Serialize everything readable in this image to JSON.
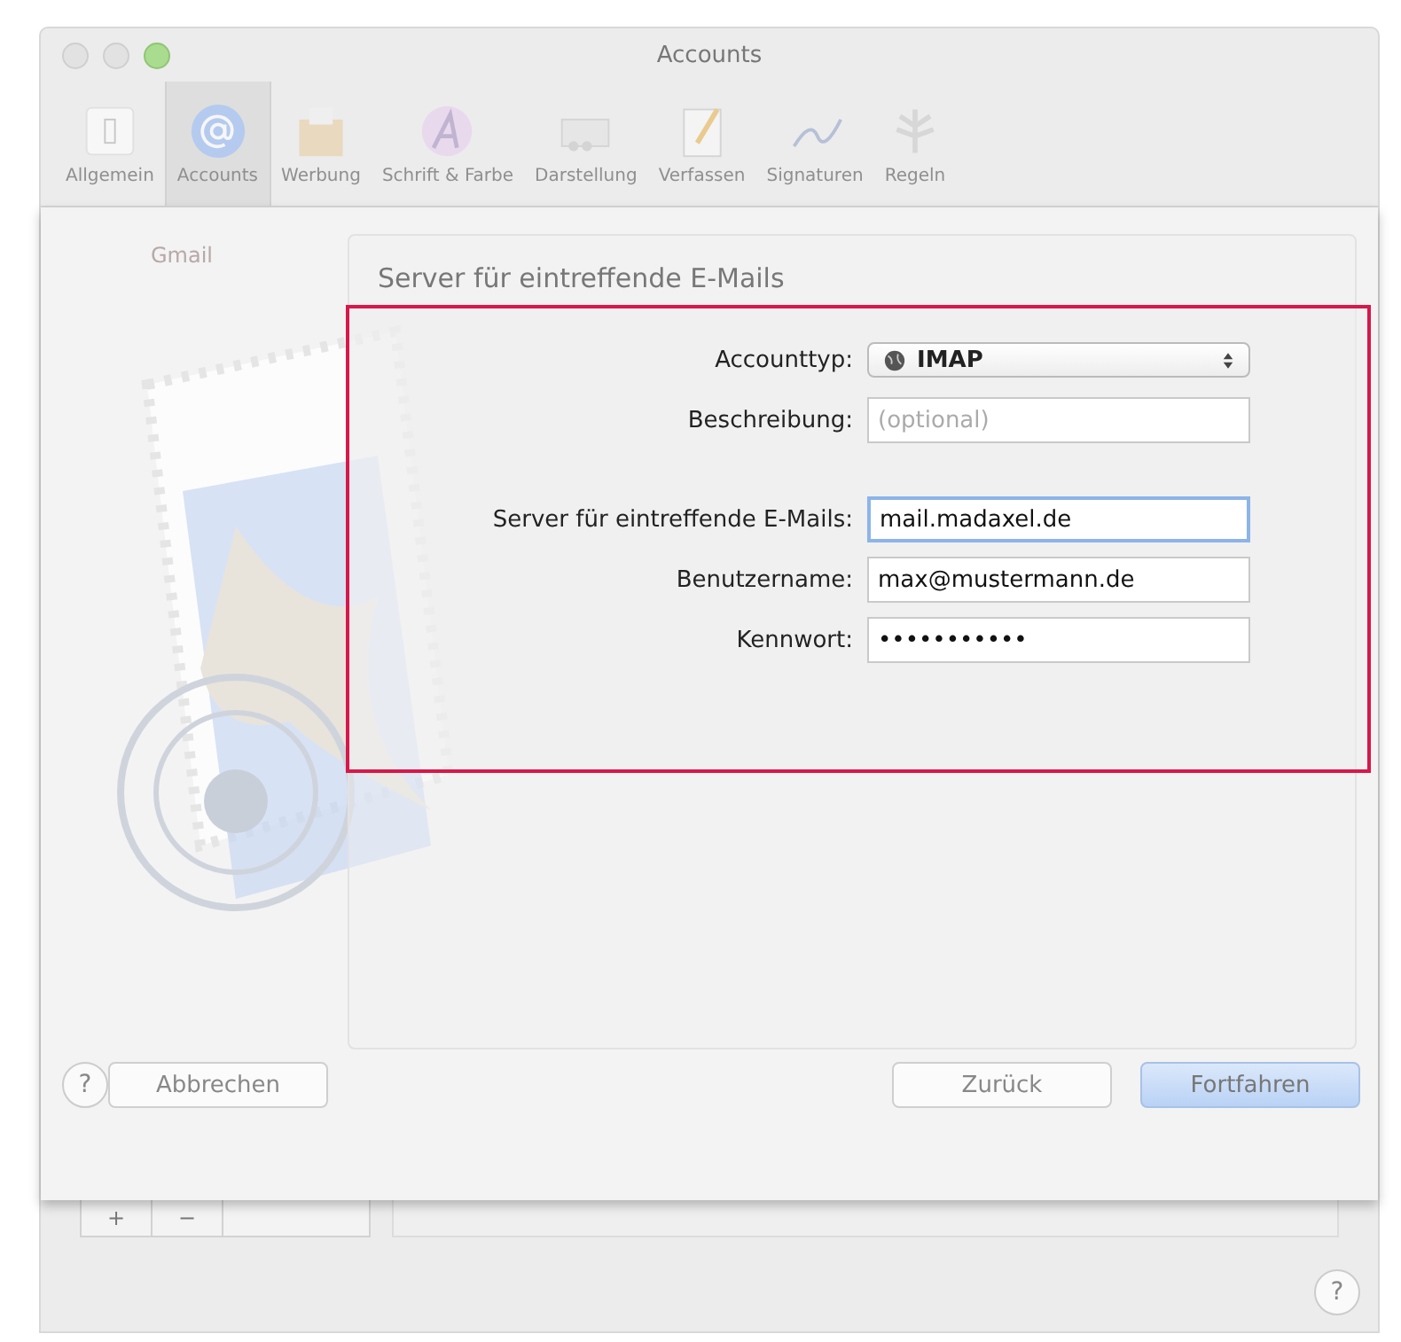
{
  "window": {
    "title": "Accounts"
  },
  "toolbar": [
    {
      "label": "Allgemein",
      "selected": false
    },
    {
      "label": "Accounts",
      "selected": true
    },
    {
      "label": "Werbung",
      "selected": false
    },
    {
      "label": "Schrift & Farbe",
      "selected": false
    },
    {
      "label": "Darstellung",
      "selected": false
    },
    {
      "label": "Verfassen",
      "selected": false
    },
    {
      "label": "Signaturen",
      "selected": false
    },
    {
      "label": "Regeln",
      "selected": false
    }
  ],
  "sidebar": {
    "items": [
      {
        "label": "Gmail"
      }
    ]
  },
  "sheet": {
    "heading": "Server für eintreffende E-Mails",
    "fields": [
      {
        "kind": "select",
        "label": "Accounttyp:",
        "value": "IMAP"
      },
      {
        "kind": "text",
        "label": "Beschreibung:",
        "placeholder": "(optional)"
      },
      {
        "kind": "text",
        "label": "Server für eintreffende E-Mails:",
        "value": "mail.madaxel.de",
        "focused": true
      },
      {
        "kind": "text",
        "label": "Benutzername:",
        "value": "max@mustermann.de"
      },
      {
        "kind": "password",
        "label": "Kennwort:",
        "value": "•••••••••••"
      }
    ],
    "buttons": [
      {
        "label": "Abbrechen",
        "default": false
      },
      {
        "label": "Zurück",
        "default": false
      },
      {
        "label": "Fortfahren",
        "default": true
      }
    ]
  },
  "account_buttons": [
    "+",
    "−"
  ],
  "help_buttons": [
    "?",
    "?"
  ]
}
